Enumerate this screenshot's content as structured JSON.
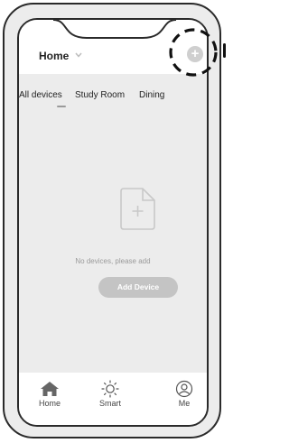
{
  "header": {
    "title": "Home",
    "add_icon": "plus-circle-icon"
  },
  "tabs": [
    {
      "label": "All devices",
      "active": true
    },
    {
      "label": "Study Room",
      "active": false
    },
    {
      "label": "Dining",
      "active": false
    }
  ],
  "tabs_more": "···",
  "empty_state": {
    "icon": "add-document-icon",
    "message": "No devices, please add",
    "button_label": "Add Device"
  },
  "bottom_nav": [
    {
      "label": "Home",
      "icon": "home-icon",
      "active": true
    },
    {
      "label": "Smart",
      "icon": "smart-sun-icon",
      "active": false
    },
    {
      "label": "Me",
      "icon": "user-icon",
      "active": false
    }
  ],
  "colors": {
    "screen_bg": "#ececec",
    "bar_bg": "#ffffff",
    "button_bg": "#c4c4c4",
    "text_muted": "#9a9a9a"
  }
}
